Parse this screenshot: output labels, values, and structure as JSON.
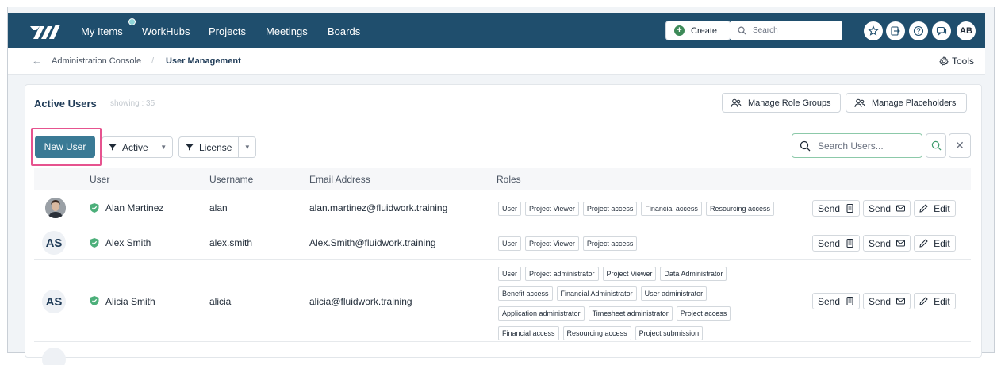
{
  "nav": {
    "items": [
      "My Items",
      "WorkHubs",
      "Projects",
      "Meetings",
      "Boards"
    ],
    "create_label": "Create",
    "search_placeholder": "Search",
    "icons": [
      "star-icon",
      "exit-icon",
      "help-icon",
      "chat-icon"
    ],
    "avatar_initials": "AB"
  },
  "breadcrumb": {
    "back": "←",
    "items": [
      "Administration Console",
      "User Management"
    ],
    "separator": "/",
    "tools_label": "Tools"
  },
  "card": {
    "title": "Active Users",
    "count_text": "showing : 35",
    "manage_role_groups": "Manage Role Groups",
    "manage_placeholders": "Manage Placeholders",
    "new_user": "New User",
    "filter_active": "Active",
    "filter_license": "License",
    "search_placeholder": "Search Users..."
  },
  "table": {
    "columns": [
      "User",
      "Username",
      "Email Address",
      "Roles"
    ],
    "rows": [
      {
        "name": "Alan Martinez",
        "username": "alan",
        "email": "alan.martinez@fluidwork.training",
        "initials": "",
        "roles": [
          "User",
          "Project Viewer",
          "Project access",
          "Financial access",
          "Resourcing access"
        ]
      },
      {
        "name": "Alex Smith",
        "username": "alex.smith",
        "email": "Alex.Smith@fluidwork.training",
        "initials": "AS",
        "roles": [
          "User",
          "Project Viewer",
          "Project access"
        ]
      },
      {
        "name": "Alicia Smith",
        "username": "alicia",
        "email": "alicia@fluidwork.training",
        "initials": "AS",
        "roles": [
          "User",
          "Project administrator",
          "Project Viewer",
          "Data Administrator",
          "Benefit access",
          "Financial Administrator",
          "User administrator",
          "Application administrator",
          "Timesheet administrator",
          "Project access",
          "Financial access",
          "Resourcing access",
          "Project submission"
        ]
      }
    ],
    "actions": {
      "send_label": "Send",
      "edit_label": "Edit"
    }
  },
  "colors": {
    "navbar": "#1f4e6d",
    "primary_button": "#3a7a95",
    "highlight": "#e6538f",
    "verified": "#4caf7a"
  }
}
